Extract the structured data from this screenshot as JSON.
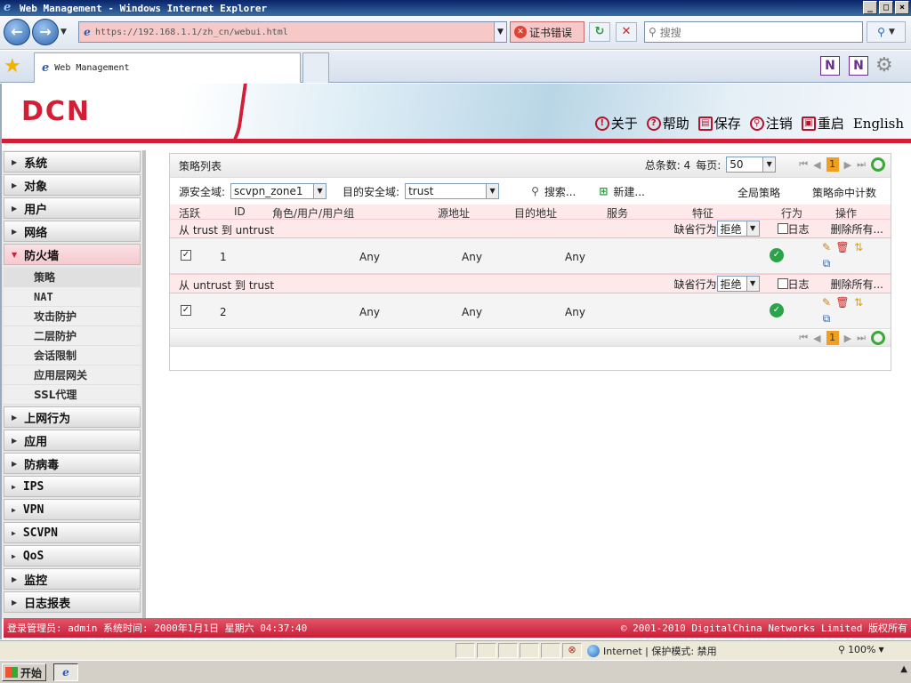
{
  "window": {
    "title": "Web Management - Windows Internet Explorer",
    "min": "_",
    "max": "□",
    "close": "×"
  },
  "browser": {
    "back": "←",
    "forward": "→",
    "url": "https://192.168.1.1/zh_cn/webui.html",
    "cert_error": "证书错误",
    "refresh": "↻",
    "stop": "✕",
    "search_placeholder": "搜搜",
    "tab_title": "Web Management"
  },
  "banner": {
    "logo": "DCN",
    "links": [
      {
        "icon": "!",
        "label": "关于"
      },
      {
        "icon": "?",
        "label": "帮助"
      },
      {
        "icon": "▤",
        "label": "保存"
      },
      {
        "icon": "⚲",
        "label": "注销"
      },
      {
        "icon": "▣",
        "label": "重启"
      }
    ],
    "lang": "English"
  },
  "sidebar": {
    "items": [
      {
        "label": "系统"
      },
      {
        "label": "对象"
      },
      {
        "label": "用户"
      },
      {
        "label": "网络"
      },
      {
        "label": "防火墙"
      }
    ],
    "firewall_sub": [
      "策略",
      "NAT",
      "攻击防护",
      "二层防护",
      "会话限制",
      "应用层网关",
      "SSL代理"
    ],
    "items_after": [
      {
        "label": "上网行为"
      },
      {
        "label": "应用"
      },
      {
        "label": "防病毒"
      },
      {
        "label": "IPS"
      },
      {
        "label": "VPN"
      },
      {
        "label": "SCVPN"
      },
      {
        "label": "QoS"
      },
      {
        "label": "监控"
      },
      {
        "label": "日志报表"
      }
    ]
  },
  "panel": {
    "title": "策略列表",
    "total_label": "总条数: 4",
    "per_page_label": "每页:",
    "per_page_value": "50",
    "current_page": "1",
    "src_zone_label": "源安全域:",
    "src_zone_value": "scvpn_zone1",
    "dst_zone_label": "目的安全域:",
    "dst_zone_value": "trust",
    "search_label": "搜索...",
    "new_label": "新建...",
    "global_policy": "全局策略",
    "hit_count": "策略命中计数",
    "columns": [
      "活跃",
      "ID",
      "角色/用户/用户组",
      "源地址",
      "目的地址",
      "服务",
      "特征",
      "行为",
      "操作"
    ],
    "groups": [
      {
        "title": "从 trust 到 untrust",
        "default_action_label": "缺省行为",
        "default_action_value": "拒绝",
        "log_label": "日志",
        "delete_all": "删除所有...",
        "row": {
          "checked": "✓",
          "id": "1",
          "src": "Any",
          "dst": "Any",
          "svc": "Any"
        }
      },
      {
        "title": "从 untrust 到 trust",
        "default_action_label": "缺省行为",
        "default_action_value": "拒绝",
        "log_label": "日志",
        "delete_all": "删除所有...",
        "row": {
          "checked": "✓",
          "id": "2",
          "src": "Any",
          "dst": "Any",
          "svc": "Any"
        }
      }
    ]
  },
  "footer": {
    "left": "登录管理员: admin 系统时间: 2000年1月1日 星期六 04:37:40",
    "right": "© 2001-2010 DigitalChina Networks Limited 版权所有"
  },
  "iestatus": {
    "zone": "Internet | 保护模式: 禁用",
    "zoom": "100%"
  },
  "taskbar": {
    "start": "开始"
  }
}
